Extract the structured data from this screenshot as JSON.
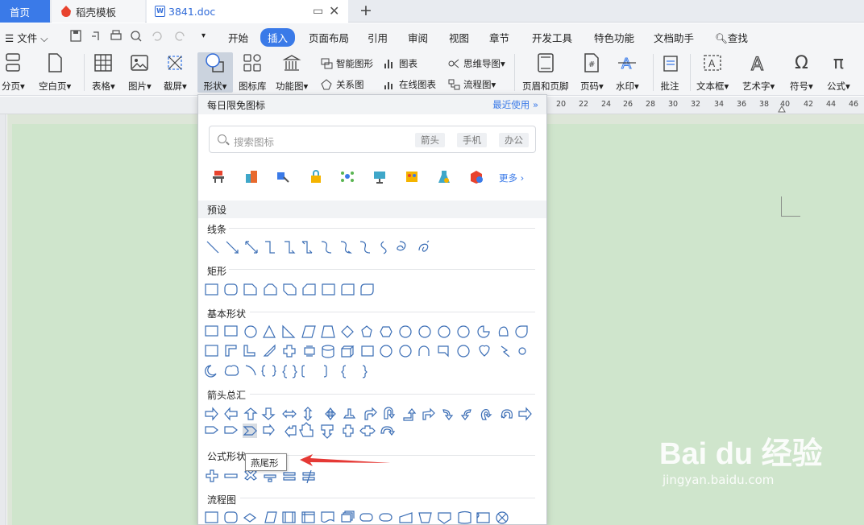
{
  "tabs": {
    "home": "首页",
    "template": "稻壳模板",
    "doc": "3841.doc"
  },
  "menu": {
    "file": "文件",
    "items": [
      "开始",
      "插入",
      "页面布局",
      "引用",
      "审阅",
      "视图",
      "章节",
      "开发工具",
      "特色功能",
      "文档助手"
    ],
    "find": "查找"
  },
  "ribbon": {
    "pagebreak": "分页",
    "blank": "空白页",
    "table": "表格",
    "picture": "图片",
    "screenshot": "截屏",
    "shape": "形状",
    "iconlib": "图标库",
    "funcchart": "功能图",
    "smartart": "智能图形",
    "chart": "图表",
    "mindmap": "思维导图",
    "relation": "关系图",
    "onlinechart": "在线图表",
    "flowchart": "流程图",
    "headerfooter": "页眉和页脚",
    "pagenum": "页码",
    "watermark": "水印",
    "comment": "批注",
    "textbox": "文本框",
    "wordart": "艺术字",
    "symbol": "符号",
    "formula": "公式"
  },
  "ruler": [
    "20",
    "22",
    "24",
    "26",
    "28",
    "30",
    "32",
    "34",
    "36",
    "38",
    "40",
    "42",
    "44",
    "46"
  ],
  "panel": {
    "title": "每日限免图标",
    "recent": "最近使用",
    "search_placeholder": "搜索图标",
    "chips": [
      "箭头",
      "手机",
      "办公"
    ],
    "more": "更多",
    "preset": "预设",
    "sections": {
      "lines": "线条",
      "rect": "矩形",
      "basic": "基本形状",
      "arrows": "箭头总汇",
      "formula": "公式形状",
      "flow": "流程图"
    },
    "tooltip": "燕尾形"
  },
  "watermark": {
    "main": "Bai du 经验",
    "sub": "jingyan.baidu.com"
  },
  "colors": {
    "accent": "#3a7ae8",
    "page": "#cfe5cc",
    "arrow": "#e53935"
  }
}
